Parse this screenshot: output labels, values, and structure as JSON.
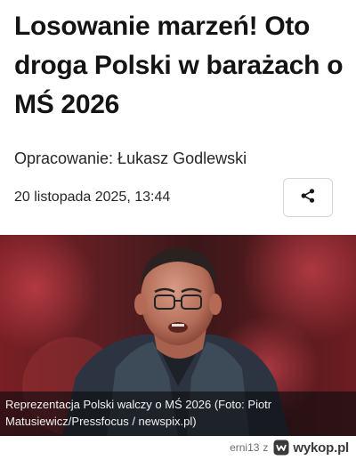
{
  "article": {
    "headline": "Losowanie marzeń! Oto droga Polski w barażach o MŚ 2026",
    "author": "Opracowanie: Łukasz Godlewski",
    "date": "20 listopada 2025, 13:44",
    "share_icon": "share-icon",
    "photo": {
      "caption": "Reprezentacja Polski walczy o MŚ 2026 (Foto: Piotr Matusiewicz/Pressfocus / newspix.pl)"
    }
  },
  "watermark": {
    "user": "erni13",
    "separator": "z",
    "site": "wykop.pl",
    "logo_icon": "wykop-logo-icon"
  }
}
